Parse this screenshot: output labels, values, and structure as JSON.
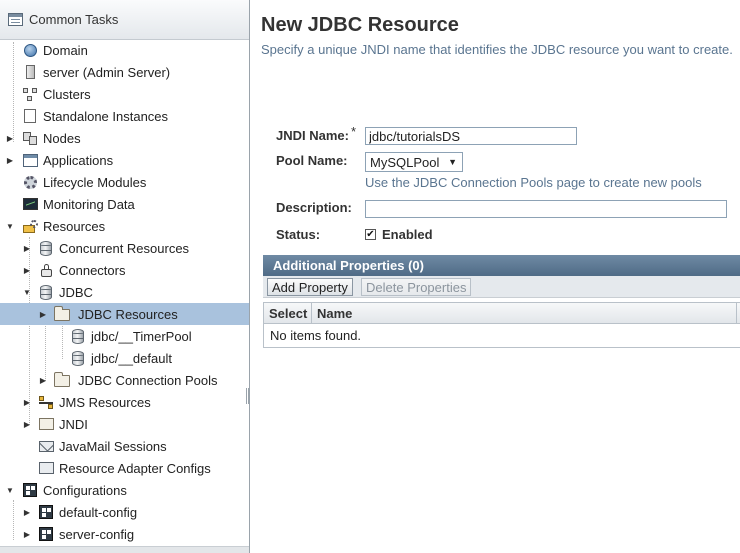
{
  "sidebar": {
    "header_title": "Common Tasks",
    "items": [
      {
        "label": "Domain",
        "icon": "globe-icon"
      },
      {
        "label": "server (Admin Server)",
        "icon": "server-icon"
      },
      {
        "label": "Clusters",
        "icon": "clusters-icon"
      },
      {
        "label": "Standalone Instances",
        "icon": "instance-icon"
      },
      {
        "label": "Nodes",
        "icon": "nodes-icon"
      },
      {
        "label": "Applications",
        "icon": "applications-icon"
      },
      {
        "label": "Lifecycle Modules",
        "icon": "gear-icon"
      },
      {
        "label": "Monitoring Data",
        "icon": "monitor-icon"
      },
      {
        "label": "Resources",
        "icon": "resources-icon"
      },
      {
        "label": "Concurrent Resources",
        "icon": "database-icon"
      },
      {
        "label": "Connectors",
        "icon": "connector-plug-icon"
      },
      {
        "label": "JDBC",
        "icon": "database-icon"
      },
      {
        "label": "JDBC Resources",
        "icon": "folder-icon"
      },
      {
        "label": "jdbc/__TimerPool",
        "icon": "database-icon"
      },
      {
        "label": "jdbc/__default",
        "icon": "database-icon"
      },
      {
        "label": "JDBC Connection Pools",
        "icon": "folder-icon"
      },
      {
        "label": "JMS Resources",
        "icon": "jms-icon"
      },
      {
        "label": "JNDI",
        "icon": "jndi-folder-icon"
      },
      {
        "label": "JavaMail Sessions",
        "icon": "mail-icon"
      },
      {
        "label": "Resource Adapter Configs",
        "icon": "adapter-icon"
      },
      {
        "label": "Configurations",
        "icon": "configuration-icon"
      },
      {
        "label": "default-config",
        "icon": "configuration-icon"
      },
      {
        "label": "server-config",
        "icon": "configuration-icon"
      }
    ]
  },
  "main": {
    "title": "New JDBC Resource",
    "help_text": "Specify a unique JNDI name that identifies the JDBC resource you want to create.",
    "form": {
      "jndi_label": "JNDI Name:",
      "required_mark": "*",
      "jndi_value": "jdbc/tutorialsDS",
      "pool_label": "Pool Name:",
      "pool_value": "MySQLPool",
      "pool_arrow": "▼",
      "pool_hint": "Use the JDBC Connection Pools page to create new pools",
      "description_label": "Description:",
      "description_value": "",
      "status_label": "Status:",
      "enabled_checkmark": "✔",
      "enabled_label": "Enabled"
    },
    "properties": {
      "header": "Additional Properties (0)",
      "add_button": "Add Property",
      "delete_button": "Delete Properties",
      "columns": [
        "Select",
        "Name"
      ],
      "empty_text": "No items found."
    }
  },
  "colors": {
    "selection": "#a9c2dd",
    "table_header": "#5b7793",
    "help_text": "#5a7590"
  }
}
